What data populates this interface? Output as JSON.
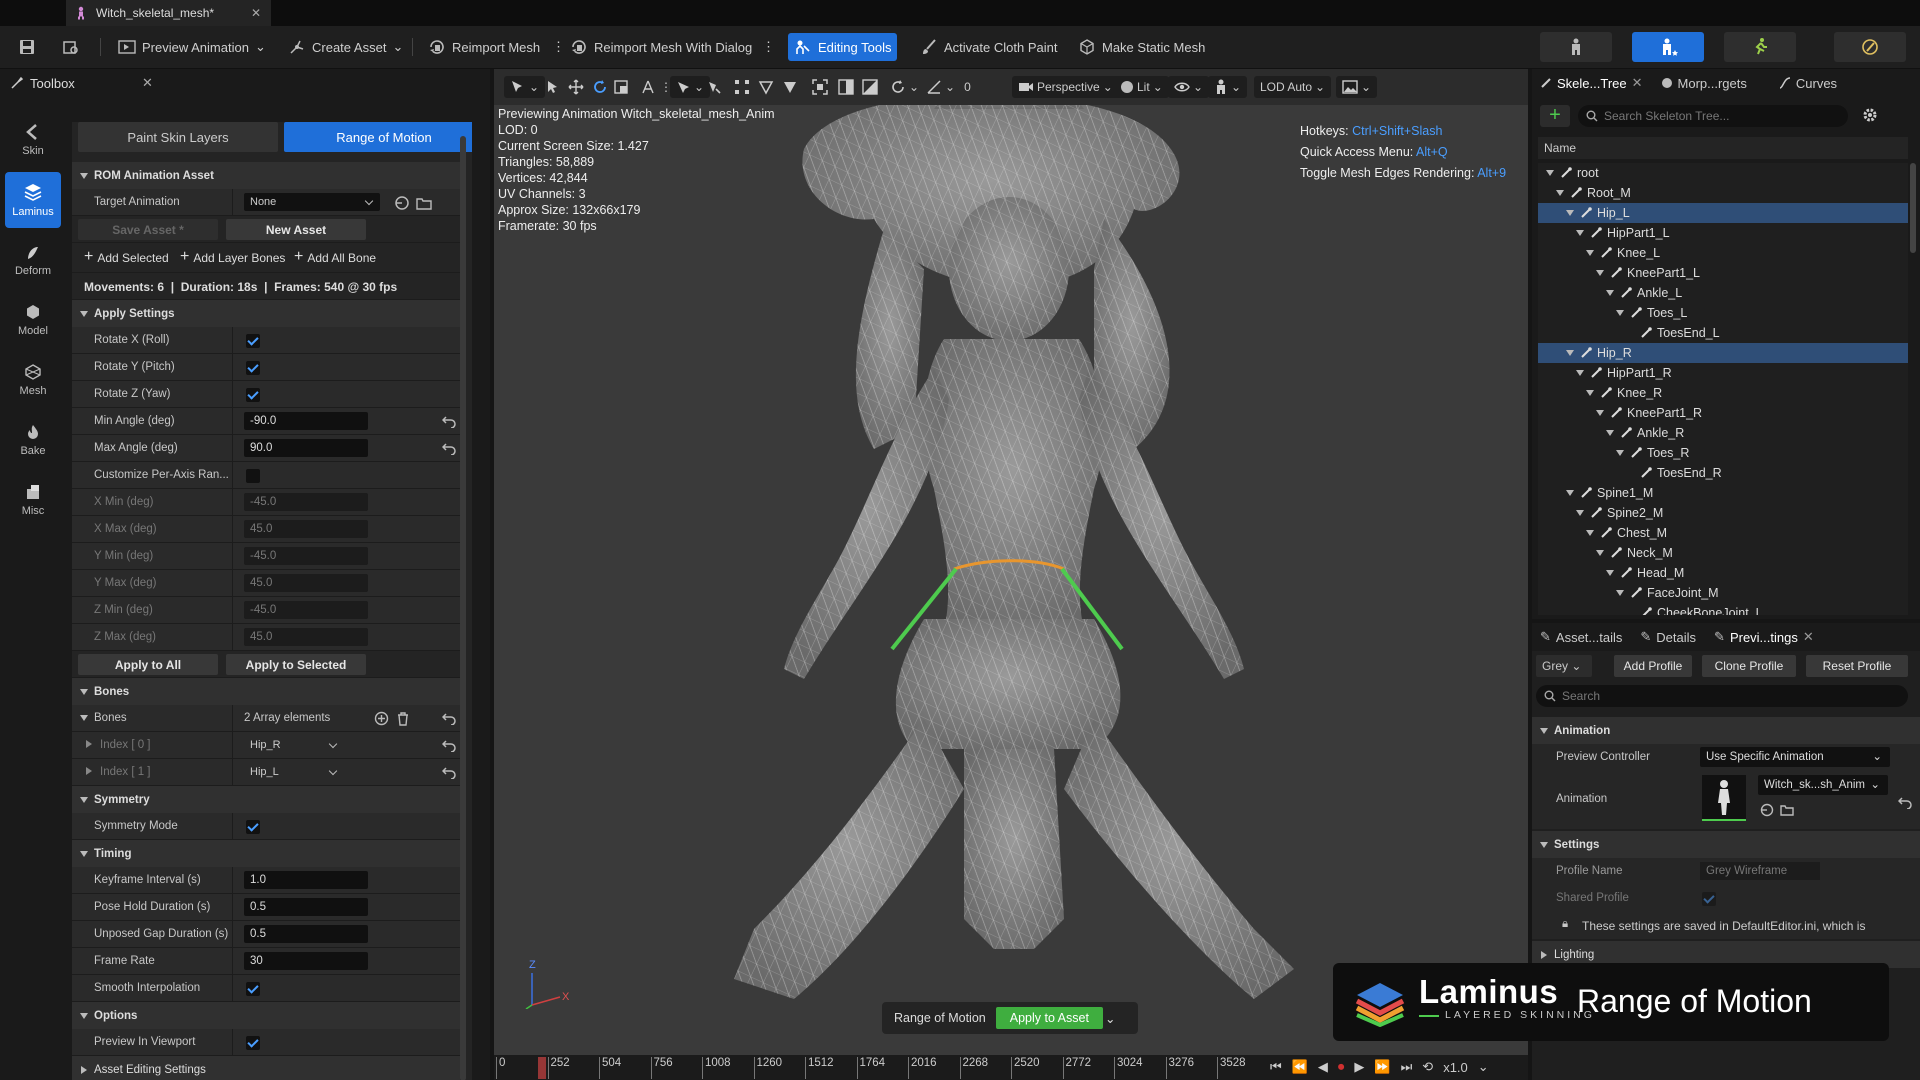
{
  "window": {
    "tab_title": "Witch_skeletal_mesh*"
  },
  "toolbar": {
    "preview_animation": "Preview Animation",
    "create_asset": "Create Asset",
    "reimport_mesh": "Reimport Mesh",
    "reimport_dialog": "Reimport Mesh With Dialog",
    "editing_tools": "Editing Tools",
    "activate_cloth": "Activate Cloth Paint",
    "make_static": "Make Static Mesh"
  },
  "toolbox": {
    "title": "Toolbox",
    "vtabs": [
      "Skin",
      "Laminus",
      "Deform",
      "Model",
      "Mesh",
      "Bake",
      "Misc"
    ],
    "active_vtab": "Laminus",
    "tab_paint": "Paint Skin Layers",
    "tab_rom": "Range of Motion"
  },
  "rom": {
    "section_asset": "ROM Animation Asset",
    "target_animation_label": "Target Animation",
    "target_animation_value": "None",
    "save_asset": "Save Asset *",
    "new_asset": "New Asset",
    "add_selected": "Add Selected",
    "add_layer_bones": "Add Layer Bones",
    "add_all_bones": "Add All Bone",
    "summary": "Movements: 6  |  Duration: 18s  |  Frames: 540 @ 30 fps",
    "section_apply": "Apply Settings",
    "rotate_x": "Rotate X (Roll)",
    "rotate_y": "Rotate Y (Pitch)",
    "rotate_z": "Rotate Z (Yaw)",
    "min_angle_label": "Min Angle (deg)",
    "min_angle": "-90.0",
    "max_angle_label": "Max Angle (deg)",
    "max_angle": "90.0",
    "custom_axis": "Customize Per-Axis Ran...",
    "x_min_label": "X Min (deg)",
    "x_min": "-45.0",
    "x_max_label": "X Max (deg)",
    "x_max": "45.0",
    "y_min_label": "Y Min (deg)",
    "y_min": "-45.0",
    "y_max_label": "Y Max (deg)",
    "y_max": "45.0",
    "z_min_label": "Z Min (deg)",
    "z_min": "-45.0",
    "z_max_label": "Z Max (deg)",
    "z_max": "45.0",
    "apply_all": "Apply to All",
    "apply_selected": "Apply to Selected",
    "section_bones": "Bones",
    "bones_label": "Bones",
    "bones_count": "2 Array elements",
    "index0_label": "Index [ 0 ]",
    "index0_value": "Hip_R",
    "index1_label": "Index [ 1 ]",
    "index1_value": "Hip_L",
    "section_symmetry": "Symmetry",
    "symmetry_mode": "Symmetry Mode",
    "section_timing": "Timing",
    "keyframe_label": "Keyframe Interval (s)",
    "keyframe": "1.0",
    "pose_hold_label": "Pose Hold Duration (s)",
    "pose_hold": "0.5",
    "unposed_label": "Unposed Gap Duration (s)",
    "unposed": "0.5",
    "frame_rate_label": "Frame Rate",
    "frame_rate": "30",
    "smooth_label": "Smooth Interpolation",
    "section_options": "Options",
    "preview_viewport": "Preview In Viewport",
    "section_asset_edit": "Asset Editing Settings"
  },
  "viewport": {
    "perspective": "Perspective",
    "lit": "Lit",
    "lod": "LOD Auto",
    "snap_value": "0",
    "stats": [
      "Previewing Animation Witch_skeletal_mesh_Anim",
      "LOD: 0",
      "Current Screen Size: 1.427",
      "Triangles: 58,889",
      "Vertices: 42,844",
      "UV Channels: 3",
      "Approx Size: 132x66x179",
      "Framerate: 30 fps"
    ],
    "hotkeys_label": "Hotkeys:",
    "hotkeys_value": "Ctrl+Shift+Slash",
    "quick_label": "Quick Access Menu:",
    "quick_value": "Alt+Q",
    "toggle_label": "Toggle Mesh Edges Rendering:",
    "toggle_value": "Alt+9",
    "rom_label": "Range of Motion",
    "apply_asset": "Apply to Asset",
    "axis_z": "Z",
    "axis_x": "X"
  },
  "timeline": {
    "ticks": [
      "0",
      "252",
      "504",
      "756",
      "1008",
      "1260",
      "1512",
      "1764",
      "2016",
      "2268",
      "2520",
      "2772",
      "3024",
      "3276",
      "3528"
    ],
    "speed": "x1.0"
  },
  "skeleton": {
    "tab_tree": "Skele...Tree",
    "tab_morph": "Morp...rgets",
    "tab_curves": "Curves",
    "search_placeholder": "Search Skeleton Tree...",
    "col_name": "Name",
    "nodes": [
      "root",
      "Root_M",
      "Hip_L",
      "HipPart1_L",
      "Knee_L",
      "KneePart1_L",
      "Ankle_L",
      "Toes_L",
      "ToesEnd_L",
      "Hip_R",
      "HipPart1_R",
      "Knee_R",
      "KneePart1_R",
      "Ankle_R",
      "Toes_R",
      "ToesEnd_R",
      "Spine1_M",
      "Spine2_M",
      "Chest_M",
      "Neck_M",
      "Head_M",
      "FaceJoint_M",
      "CheekBoneJoint_L"
    ]
  },
  "details": {
    "tab_asset": "Asset...tails",
    "tab_details": "Details",
    "tab_preview": "Previ...tings",
    "grey": "Grey",
    "add_profile": "Add Profile",
    "clone_profile": "Clone Profile",
    "reset_profile": "Reset Profile",
    "search_placeholder": "Search",
    "section_animation": "Animation",
    "preview_controller_label": "Preview Controller",
    "preview_controller": "Use Specific Animation",
    "animation_label": "Animation",
    "animation_value": "Witch_sk...sh_Anim",
    "section_settings": "Settings",
    "profile_name_label": "Profile Name",
    "profile_name": "Grey Wireframe",
    "shared_profile": "Shared Profile",
    "note": "These settings are saved in DefaultEditor.ini, which is",
    "section_lighting": "Lighting"
  },
  "brand": {
    "name": "Laminus",
    "tagline": "LAYERED SKINNING",
    "feature": "Range of Motion"
  },
  "colors": {
    "accent": "#1f6fd9",
    "apply_green": "#3fae3f",
    "hotkey_blue": "#4a9eff",
    "selection": "#2f4e77"
  }
}
